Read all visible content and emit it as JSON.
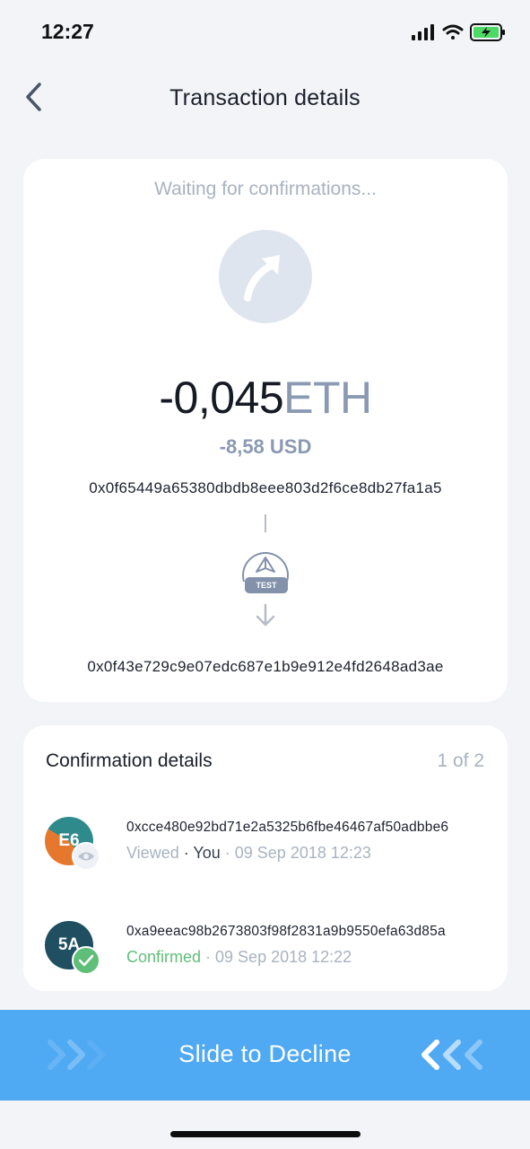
{
  "status_bar": {
    "time": "12:27",
    "icons": [
      "cellular-signal-icon",
      "wifi-icon",
      "battery-charging-icon"
    ]
  },
  "nav": {
    "back_icon": "chevron-left-icon",
    "title": "Transaction details"
  },
  "transaction": {
    "status": "Waiting for confirmations...",
    "direction_icon": "outgoing-arrow-icon",
    "amount": "-0,045",
    "currency": "ETH",
    "fiat_amount": "-8,58 USD",
    "from_address": "0x0f65449a65380dbdb8eee803d2f6ce8db27fa1a5",
    "network_icon": "ethereum-network-icon",
    "network_label": "TEST",
    "to_address": "0x0f43e729c9e07edc687e1b9e912e4fd2648ad3ae"
  },
  "confirmations": {
    "title": "Confirmation details",
    "count": "1 of 2",
    "signers": [
      {
        "avatar_text": "E6",
        "status_icon": "eye-icon",
        "address": "0xcce480e92bd71e2a5325b6fbe46467af50adbbe6",
        "status": "Viewed",
        "separator1": " · ",
        "who": "You",
        "timestamp": " · 09 Sep 2018 12:23"
      },
      {
        "avatar_text": "5A",
        "status_icon": "checkmark-icon",
        "address": "0xa9eeac98b2673803f98f2831a9b9550efa63d85a",
        "status": "Confirmed",
        "timestamp": " · 09 Sep 2018 12:22"
      }
    ]
  },
  "slider": {
    "label": "Slide to Decline",
    "left_icon": "triple-chevron-right-icon",
    "right_icon": "triple-chevron-left-icon"
  },
  "colors": {
    "accent": "#4fa9f3",
    "muted": "#a9b3c0",
    "currency": "#8a9ab3",
    "confirmed": "#5fbf78"
  }
}
